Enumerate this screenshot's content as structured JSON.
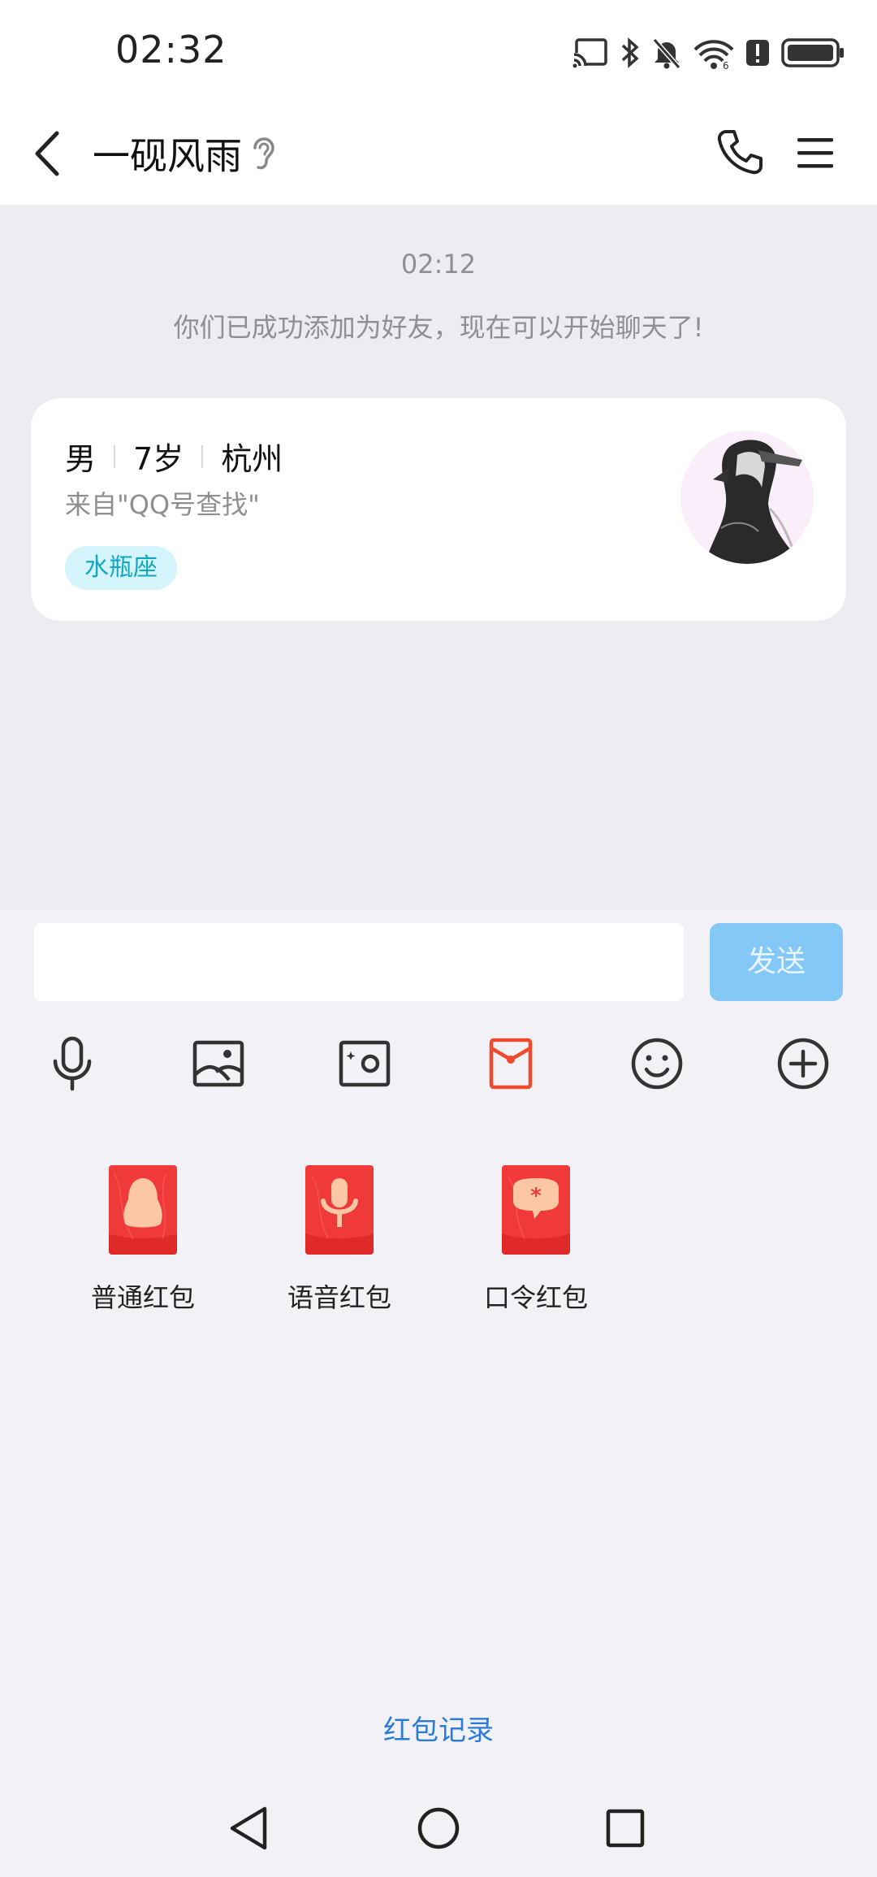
{
  "status_bar": {
    "time": "02:32",
    "icons": [
      "cast-icon",
      "bluetooth-icon",
      "mute-icon",
      "wifi-icon",
      "alert-icon",
      "battery-icon"
    ]
  },
  "header": {
    "title": "一砚风雨",
    "icons": [
      "back-icon",
      "ear-icon",
      "phone-icon",
      "menu-icon"
    ]
  },
  "chat": {
    "timestamp": "02:12",
    "system_message": "你们已成功添加为好友，现在可以开始聊天了!",
    "profile": {
      "gender": "男",
      "age": "7岁",
      "city": "杭州",
      "source": "来自\"QQ号查找\"",
      "tag": "水瓶座"
    }
  },
  "composer": {
    "input_value": "",
    "input_placeholder": "",
    "send_label": "发送",
    "toolbar_icons": [
      "microphone-icon",
      "image-icon",
      "camera-icon",
      "red-packet-icon",
      "emoji-icon",
      "plus-icon"
    ]
  },
  "red_packets": {
    "items": [
      {
        "label": "普通红包",
        "icon": "penguin-red-packet-icon"
      },
      {
        "label": "语音红包",
        "icon": "voice-red-packet-icon"
      },
      {
        "label": "口令红包",
        "icon": "password-red-packet-icon"
      }
    ],
    "records_link": "红包记录"
  },
  "nav_bar": {
    "icons": [
      "nav-back-icon",
      "nav-home-icon",
      "nav-recents-icon"
    ]
  },
  "colors": {
    "accent_blue": "#2b7bd8",
    "send_button": "#84c8f8",
    "red_packet": "#f03a3a",
    "tag_bg": "#d4f5fb",
    "tag_text": "#12a8c4"
  }
}
